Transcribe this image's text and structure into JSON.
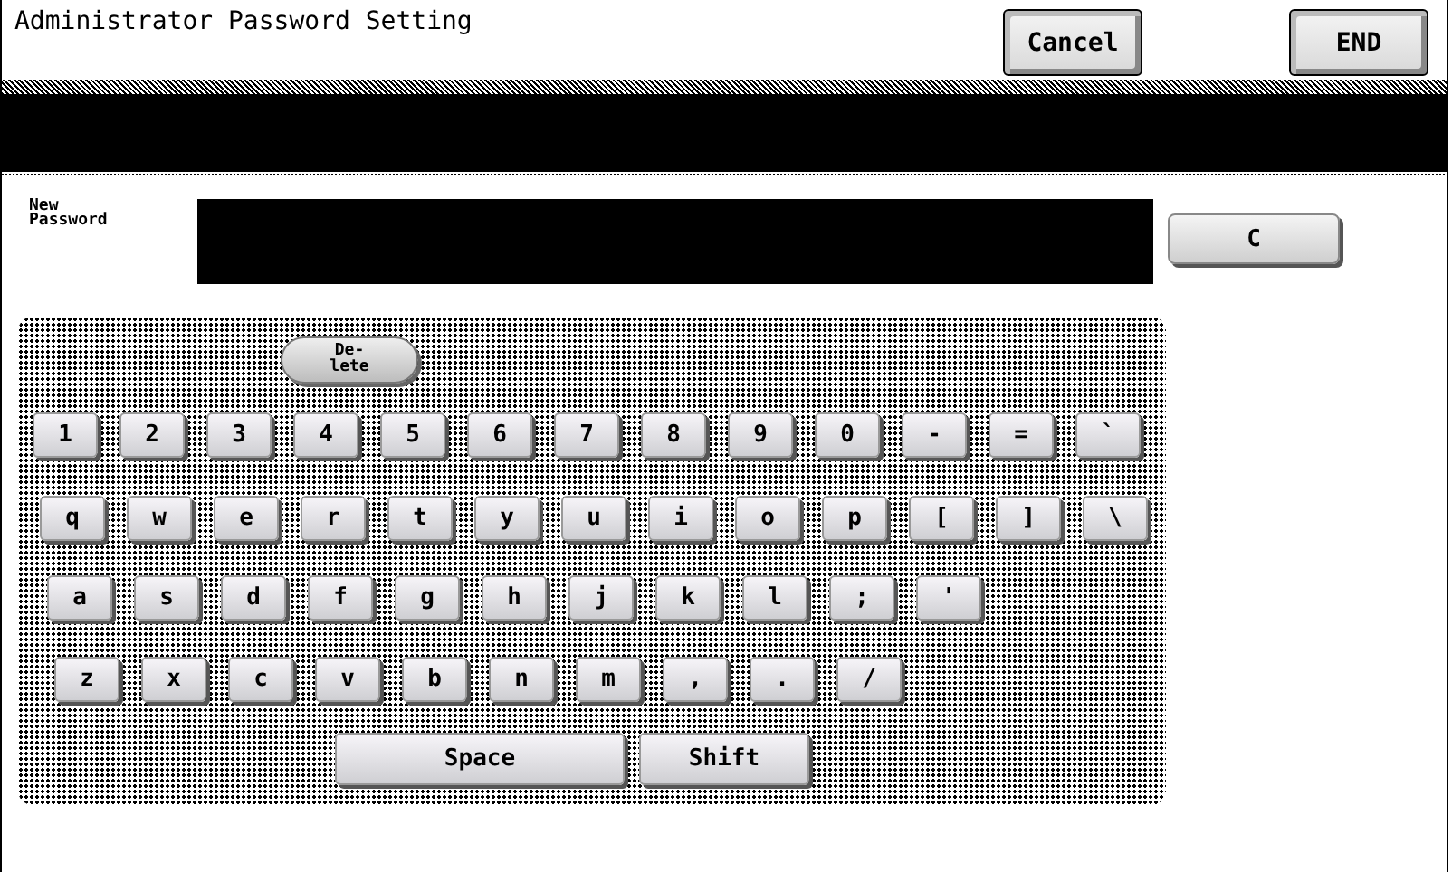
{
  "window": {
    "title": "Administrator Password Setting"
  },
  "header_buttons": [
    {
      "label": "Cancel"
    },
    {
      "label": "END"
    }
  ],
  "password_field": {
    "label": "New Password"
  },
  "clear_button": {
    "label": "C"
  },
  "keyboard": {
    "delete_key": "De-lete",
    "rows": [
      [
        "1",
        "2",
        "3",
        "4",
        "5",
        "6",
        "7",
        "8",
        "9",
        "0",
        "-",
        "=",
        "`"
      ],
      [
        "q",
        "w",
        "e",
        "r",
        "t",
        "y",
        "u",
        "i",
        "o",
        "p",
        "[",
        "]",
        "\\"
      ],
      [
        "a",
        "s",
        "d",
        "f",
        "g",
        "h",
        "j",
        "k",
        "l",
        ";",
        "'"
      ],
      [
        "z",
        "x",
        "c",
        "v",
        "b",
        "n",
        "m",
        ",",
        ".",
        "/"
      ]
    ],
    "bottom_keys": [
      "Space",
      "Shift"
    ]
  }
}
